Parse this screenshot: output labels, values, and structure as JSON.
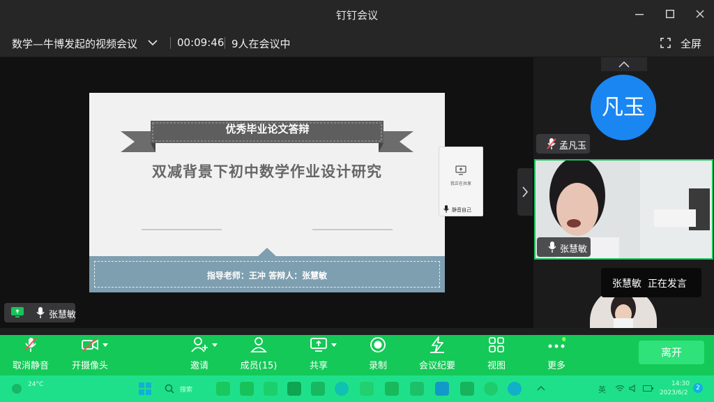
{
  "window": {
    "title": "钉钉会议"
  },
  "meeting": {
    "name": "数学—牛博发起的视频会议",
    "elapsed": "00:09:46",
    "participants_text": "9人在会议中",
    "fullscreen_label": "全屏"
  },
  "slide": {
    "ribbon_title": "优秀毕业论文答辩",
    "main_title": "双减背景下初中数学作业设计研究",
    "footer_text": "指导老师：王冲    答辩人：张慧敏"
  },
  "share_panel": {
    "sharing_text": "我正在共享",
    "mic_text": "静音自己"
  },
  "presenter_chip": {
    "name": "张慧敏"
  },
  "right_panel": {
    "avatar_text": "凡玉",
    "avatar_color": "#1a86f2",
    "avatar_name": "孟凡玉",
    "video_name": "张慧敏",
    "speaking_name": "张慧敏",
    "speaking_status": "正在发言"
  },
  "toolbar": {
    "items": [
      {
        "label": "取消静音",
        "icon": "microphone-icon"
      },
      {
        "label": "开摄像头",
        "icon": "camera-icon"
      },
      {
        "label": "邀请",
        "icon": "add-user-icon"
      },
      {
        "label": "成员(15)",
        "icon": "members-icon"
      },
      {
        "label": "共享",
        "icon": "share-screen-icon"
      },
      {
        "label": "录制",
        "icon": "record-icon"
      },
      {
        "label": "会议纪要",
        "icon": "minutes-icon"
      },
      {
        "label": "视图",
        "icon": "grid-view-icon"
      },
      {
        "label": "更多",
        "icon": "more-icon"
      }
    ],
    "leave_label": "离开",
    "accent_color": "#14c957"
  },
  "taskbar": {
    "weather_temp": "24°C",
    "search_placeholder": "搜索",
    "ime_label": "英",
    "time": "14:30",
    "date": "2023/6/2",
    "notification_count": "2"
  }
}
